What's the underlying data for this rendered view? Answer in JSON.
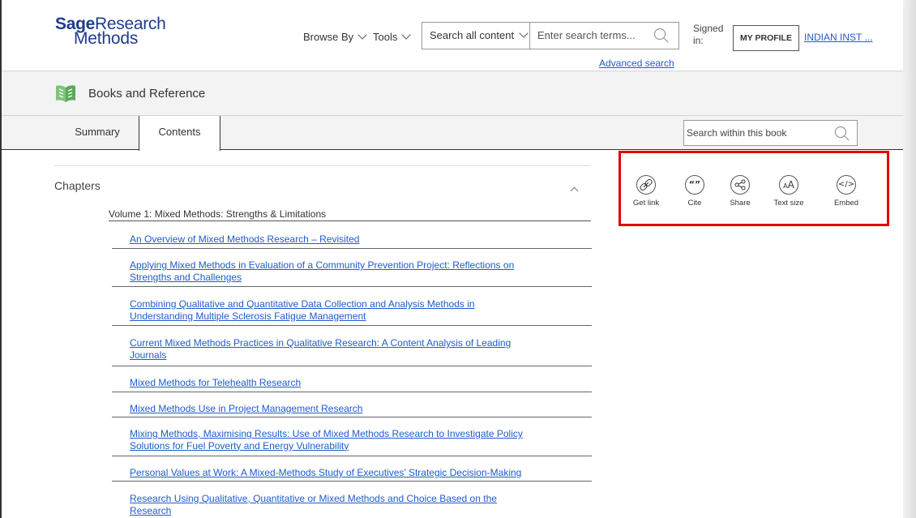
{
  "header": {
    "logo_line1_bold": "Sage",
    "logo_line1_rest": "Research",
    "logo_line2": "Methods",
    "browse_label": "Browse By",
    "tools_label": "Tools",
    "search_scope": "Search all content",
    "search_placeholder": "Enter search terms...",
    "advanced_search": "Advanced search",
    "signed_in_line1": "Signed",
    "signed_in_line2": "in:",
    "profile_button": "MY PROFILE",
    "institution_link": "INDIAN INST ..."
  },
  "band": {
    "title": "Books and Reference",
    "icon": "open-book-icon",
    "icon_color": "#6cc070"
  },
  "tabs": [
    {
      "label": "Summary",
      "active": false
    },
    {
      "label": "Contents",
      "active": true
    }
  ],
  "book_search": {
    "placeholder": "Search within this book"
  },
  "contents": {
    "section_label": "Chapters",
    "volume": "Volume 1: Mixed Methods: Strengths & Limitations",
    "chapters": [
      {
        "line1": "An Overview of Mixed Methods Research – Revisited",
        "line2": ""
      },
      {
        "line1": "Applying Mixed Methods in Evaluation of a Community Prevention Project: Reflections on",
        "line2": "Strengths and Challenges"
      },
      {
        "line1": "Combining Qualitative and Quantitative Data Collection and Analysis Methods in",
        "line2": "Understanding Multiple Sclerosis Fatigue Management"
      },
      {
        "line1": "Current Mixed Methods Practices in Qualitative Research: A Content Analysis of Leading",
        "line2": "Journals"
      },
      {
        "line1": "Mixed Methods for Telehealth Research",
        "line2": ""
      },
      {
        "line1": "Mixed Methods Use in Project Management Research",
        "line2": ""
      },
      {
        "line1": "Mixing Methods, Maximising Results: Use of Mixed Methods Research to Investigate Policy",
        "line2": "Solutions for Fuel Poverty and Energy Vulnerability"
      },
      {
        "line1": "Personal Values at Work: A Mixed-Methods Study of Executives’ Strategic Decision-Making",
        "line2": ""
      },
      {
        "line1": "Research Using Qualitative, Quantitative or Mixed Methods and Choice Based on the",
        "line2": "Research"
      }
    ]
  },
  "tools": [
    {
      "label": "Get link",
      "icon": "link-icon"
    },
    {
      "label": "Cite",
      "icon": "quote-icon"
    },
    {
      "label": "Share",
      "icon": "share-icon"
    },
    {
      "label": "Text size",
      "icon": "text-size-icon"
    },
    {
      "label": "Embed",
      "icon": "embed-icon"
    }
  ],
  "colors": {
    "link": "#1e5ccc",
    "brand": "#1f3b8f",
    "highlight": "#e00000"
  }
}
